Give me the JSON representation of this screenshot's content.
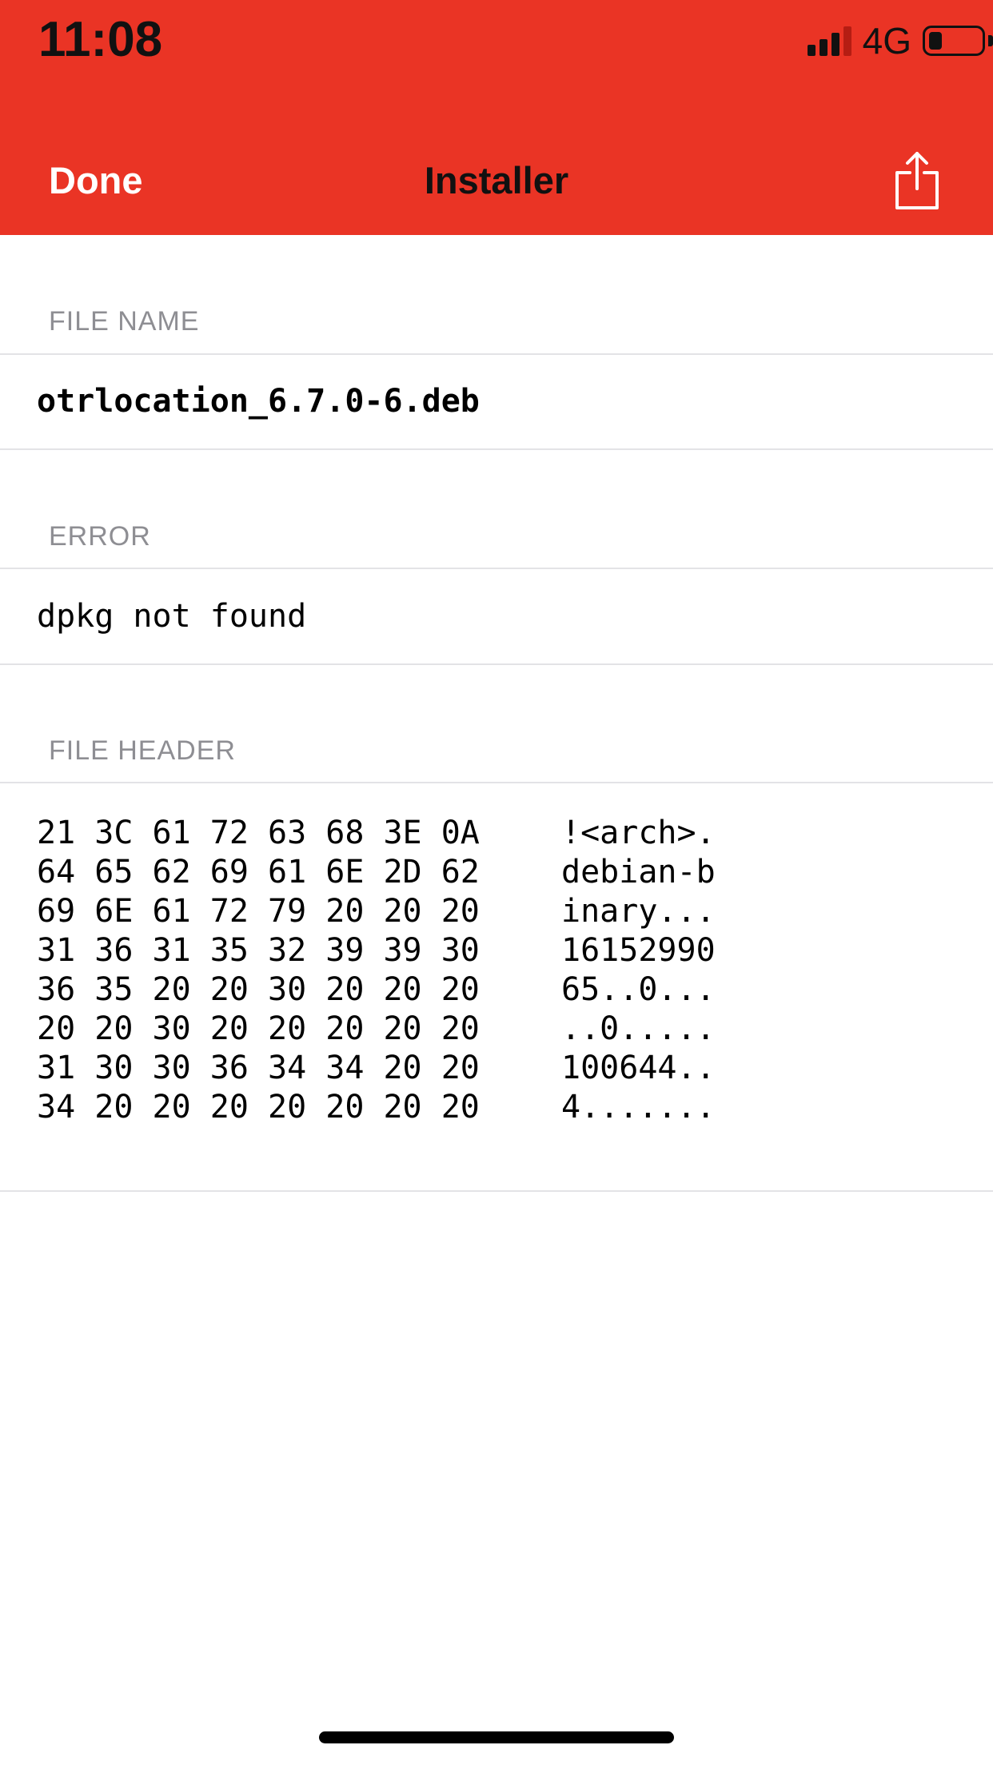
{
  "status_bar": {
    "time": "11:08",
    "network": "4G",
    "battery_level": 0.25
  },
  "nav": {
    "done_label": "Done",
    "title": "Installer",
    "share_icon": "share-icon"
  },
  "sections": {
    "file_name": {
      "header": "FILE NAME",
      "value": "otrlocation_6.7.0-6.deb"
    },
    "error": {
      "header": "ERROR",
      "value": "dpkg not found"
    },
    "file_header": {
      "header": "FILE HEADER",
      "rows": [
        {
          "hex": "21 3C 61 72 63 68 3E 0A",
          "ascii": "!<arch>."
        },
        {
          "hex": "64 65 62 69 61 6E 2D 62",
          "ascii": "debian-b"
        },
        {
          "hex": "69 6E 61 72 79 20 20 20",
          "ascii": "inary..."
        },
        {
          "hex": "31 36 31 35 32 39 39 30",
          "ascii": "16152990"
        },
        {
          "hex": "36 35 20 20 30 20 20 20",
          "ascii": "65..0..."
        },
        {
          "hex": "20 20 30 20 20 20 20 20",
          "ascii": "..0....."
        },
        {
          "hex": "31 30 30 36 34 34 20 20",
          "ascii": "100644.."
        },
        {
          "hex": "34 20 20 20 20 20 20 20",
          "ascii": "4......."
        }
      ]
    }
  },
  "colors": {
    "accent": "#ea3425",
    "section_header": "#8e8e93",
    "separator": "#e3e3e6"
  }
}
